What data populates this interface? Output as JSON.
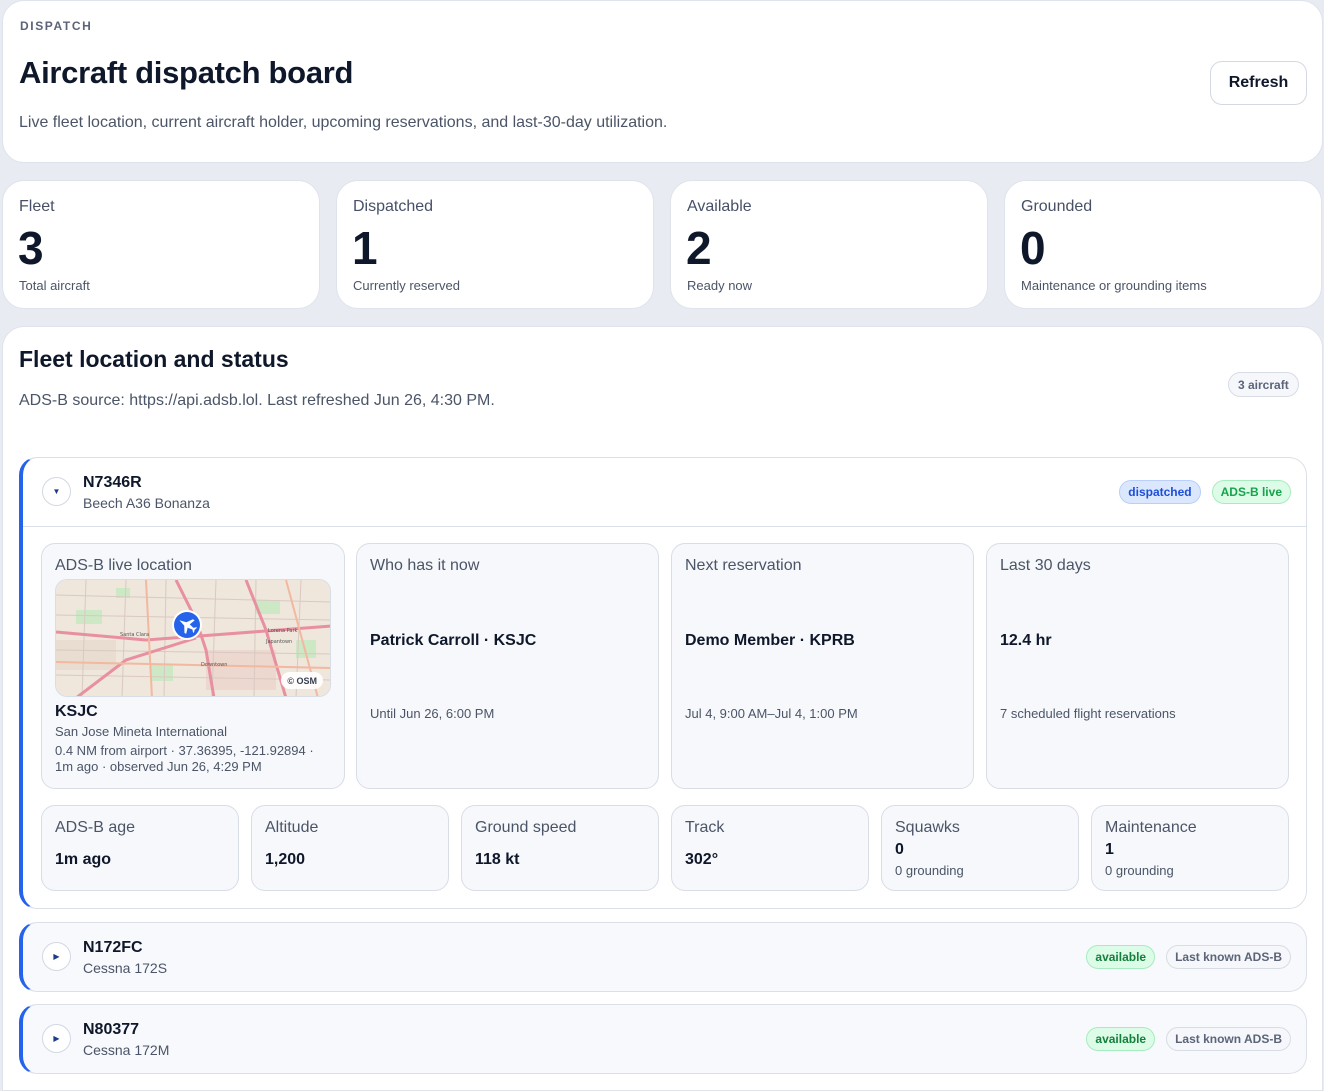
{
  "header": {
    "eyebrow": "DISPATCH",
    "title": "Aircraft dispatch board",
    "subtitle": "Live fleet location, current aircraft holder, upcoming reservations, and last-30-day utilization.",
    "refresh_label": "Refresh"
  },
  "stats": [
    {
      "label": "Fleet",
      "value": "3",
      "note": "Total aircraft"
    },
    {
      "label": "Dispatched",
      "value": "1",
      "note": "Currently reserved"
    },
    {
      "label": "Available",
      "value": "2",
      "note": "Ready now"
    },
    {
      "label": "Grounded",
      "value": "0",
      "note": "Maintenance or grounding items"
    }
  ],
  "fleet": {
    "title": "Fleet location and status",
    "source": "ADS-B source: https://api.adsb.lol. Last refreshed Jun 26, 4:30 PM.",
    "count_badge": "3 aircraft",
    "aircraft": [
      {
        "tail": "N7346R",
        "model": "Beech A36 Bonanza",
        "status": "dispatched",
        "adsb": "ADS-B live",
        "toggle": "▼",
        "location": {
          "label": "ADS-B live location",
          "osm": "© OSM",
          "code": "KSJC",
          "name": "San Jose Mineta International",
          "coords": "0.4 NM from airport · 37.36395, -121.92894 · 1m ago · observed Jun 26, 4:29 PM",
          "map_labels": [
            "Santa Clara",
            "Lorena Park",
            "Japantown",
            "Downtown"
          ]
        },
        "holder": {
          "label": "Who has it now",
          "main": "Patrick Carroll · KSJC",
          "sub": "Until Jun 26, 6:00 PM"
        },
        "next": {
          "label": "Next reservation",
          "main": "Demo Member · KPRB",
          "sub": "Jul 4, 9:00 AM–Jul 4, 1:00 PM"
        },
        "last30": {
          "label": "Last 30 days",
          "main": "12.4 hr",
          "sub": "7 scheduled flight reservations"
        },
        "metrics": {
          "adsb_age": {
            "label": "ADS-B age",
            "value": "1m ago"
          },
          "altitude": {
            "label": "Altitude",
            "value": "1,200"
          },
          "ground_speed": {
            "label": "Ground speed",
            "value": "118 kt"
          },
          "track": {
            "label": "Track",
            "value": "302°"
          },
          "squawks": {
            "label": "Squawks",
            "value": "0",
            "note": "0 grounding"
          },
          "maintenance": {
            "label": "Maintenance",
            "value": "1",
            "note": "0 grounding"
          }
        }
      },
      {
        "tail": "N172FC",
        "model": "Cessna 172S",
        "status": "available",
        "adsb": "Last known ADS-B",
        "toggle": "▶"
      },
      {
        "tail": "N80377",
        "model": "Cessna 172M",
        "status": "available",
        "adsb": "Last known ADS-B",
        "toggle": "▶"
      }
    ]
  },
  "colors": {
    "accent": "#2563eb",
    "dispatched_badge": "#dbe7fd",
    "live_badge": "#dcfce7",
    "page_bg": "#e8ebf2"
  },
  "icons": {
    "toggle_expanded": "chevron-down-icon",
    "toggle_collapsed": "chevron-right-icon",
    "map_marker": "airplane-icon"
  }
}
